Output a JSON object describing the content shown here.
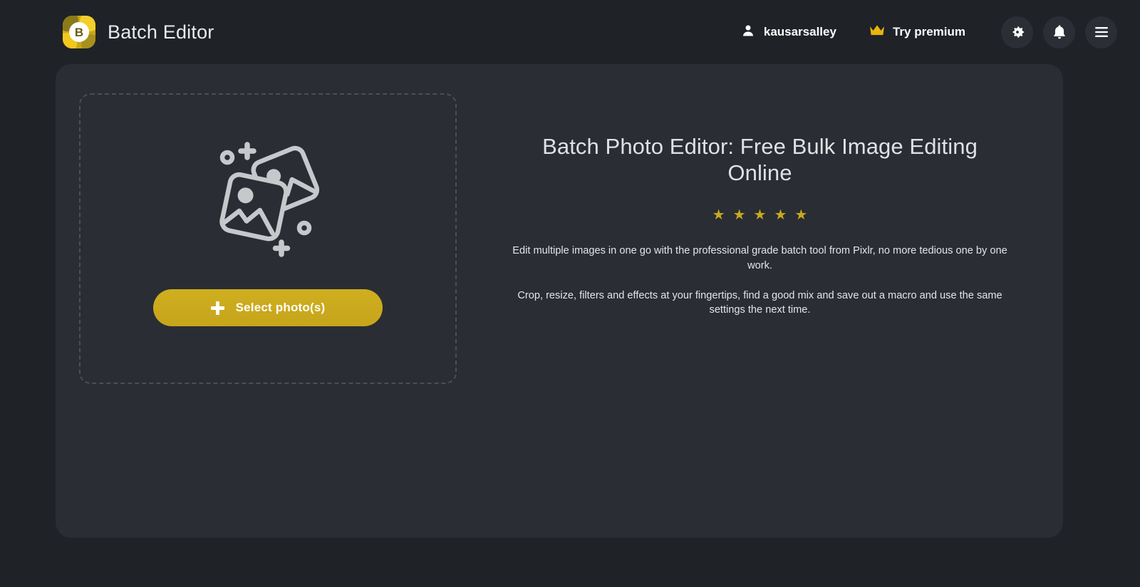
{
  "header": {
    "logo_letter": "B",
    "title": "Batch Editor",
    "user": {
      "name": "kausarsalley",
      "icon": "person-icon"
    },
    "premium": {
      "label": "Try premium",
      "icon": "crown-icon",
      "color": "#e8b50d"
    },
    "buttons": [
      {
        "name": "settings-button",
        "icon": "gear-icon"
      },
      {
        "name": "notifications-button",
        "icon": "bell-icon"
      },
      {
        "name": "menu-button",
        "icon": "hamburger-icon"
      }
    ]
  },
  "dropzone": {
    "illustration_icon": "photos-stack-icon",
    "select_button_label": "Select photo(s)",
    "select_button_icon": "plus-icon",
    "accent_color": "#c7a51c"
  },
  "info": {
    "title": "Batch Photo Editor: Free Bulk Image Editing Online",
    "rating": {
      "stars": "★ ★ ★ ★ ★",
      "count": 5,
      "color": "#c9a91d"
    },
    "paragraph_1": "Edit multiple images in one go with the professional grade batch tool from Pixlr, no more tedious one by one work.",
    "paragraph_2": "Crop, resize, filters and effects at your fingertips, find a good mix and save out a macro and use the same settings the next time."
  },
  "theme": {
    "page_background": "#1f2227",
    "panel_background": "#2a2d33",
    "icon_button_background": "#2b2e34",
    "dashed_border": "#4b4e55"
  }
}
